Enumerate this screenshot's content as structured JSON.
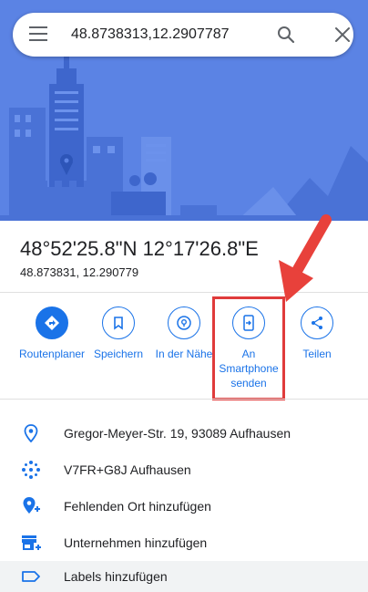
{
  "search": {
    "query": "48.8738313,12.2907787"
  },
  "place": {
    "title": "48°52'25.8\"N 12°17'26.8\"E",
    "subtitle": "48.873831, 12.290779"
  },
  "actions": [
    {
      "label": "Routenplaner"
    },
    {
      "label": "Speichern"
    },
    {
      "label": "In der Nähe"
    },
    {
      "label_line1": "An",
      "label_line2": "Smartphone",
      "label_line3": "senden"
    },
    {
      "label": "Teilen"
    }
  ],
  "details": [
    {
      "text": "Gregor-Meyer-Str. 19, 93089 Aufhausen",
      "icon": "location-pin-icon"
    },
    {
      "text": "V7FR+G8J Aufhausen",
      "icon": "plus-code-icon"
    },
    {
      "text": "Fehlenden Ort hinzufügen",
      "icon": "add-place-icon"
    },
    {
      "text": "Unternehmen hinzufügen",
      "icon": "add-business-icon"
    },
    {
      "text": "Labels hinzufügen",
      "icon": "label-icon"
    }
  ],
  "colors": {
    "accent": "#1a73e8",
    "hero": "#5a82e3",
    "highlight": "#e03b3b"
  }
}
